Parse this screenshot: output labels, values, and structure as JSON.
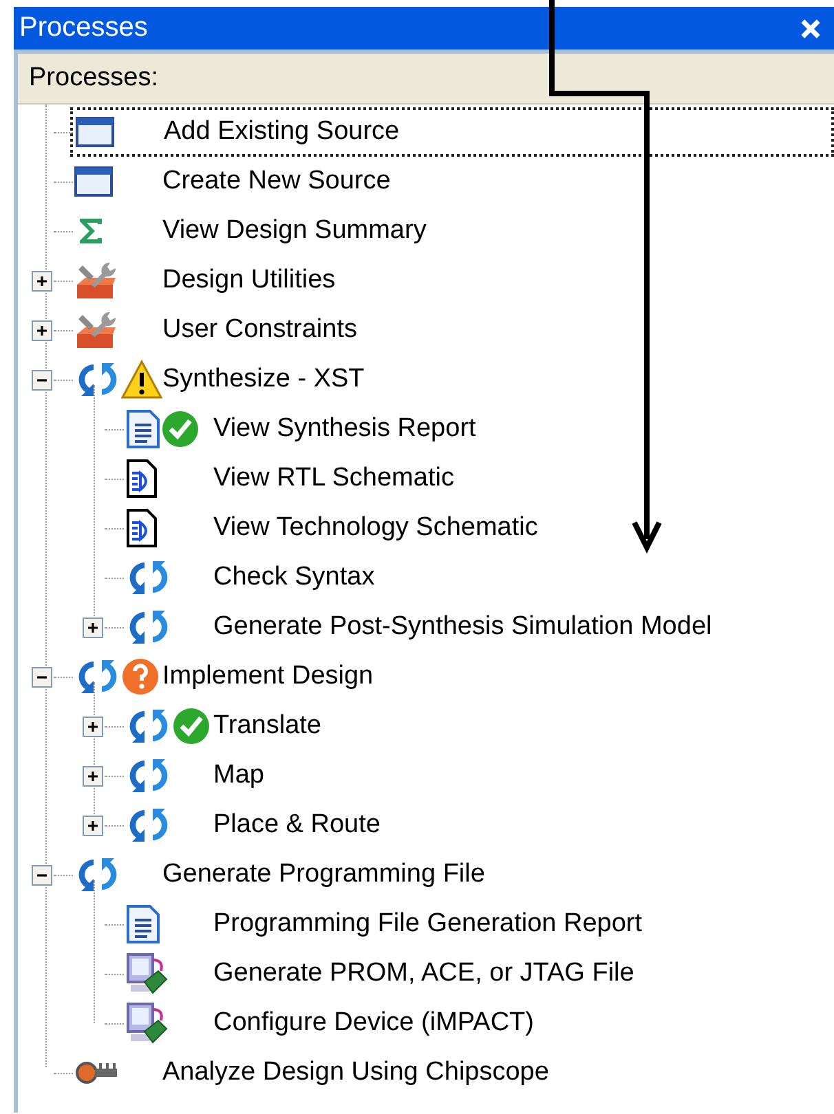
{
  "title": "Processes",
  "header": "Processes:",
  "items": [
    {
      "label": "Add Existing Source",
      "kind": "window",
      "selected": true
    },
    {
      "label": "Create New Source",
      "kind": "window",
      "selected": false
    },
    {
      "label": "View Design Summary",
      "kind": "sigma",
      "selected": false
    },
    {
      "label": "Design Utilities",
      "kind": "tools",
      "selected": false,
      "expanded": false
    },
    {
      "label": "User Constraints",
      "kind": "tools",
      "selected": false,
      "expanded": false
    },
    {
      "label": "Synthesize - XST",
      "kind": "run",
      "badge": {
        "kind": "warning"
      },
      "selected": false,
      "expanded": true,
      "children": [
        {
          "label": "View Synthesis Report",
          "kind": "report",
          "badge": {
            "kind": "ok"
          },
          "selected": false
        },
        {
          "label": "View RTL Schematic",
          "kind": "schematic",
          "selected": false
        },
        {
          "label": "View Technology Schematic",
          "kind": "schematic",
          "selected": false
        },
        {
          "label": "Check Syntax",
          "kind": "run",
          "selected": false
        },
        {
          "label": "Generate Post-Synthesis Simulation Model",
          "kind": "run",
          "selected": false,
          "expanded": false
        }
      ]
    },
    {
      "label": "Implement Design",
      "kind": "run",
      "badge": {
        "kind": "question"
      },
      "selected": false,
      "expanded": true,
      "children": [
        {
          "label": "Translate",
          "kind": "run",
          "badge": {
            "kind": "ok"
          },
          "selected": false,
          "expanded": false
        },
        {
          "label": "Map",
          "kind": "run",
          "selected": false,
          "expanded": false
        },
        {
          "label": "Place & Route",
          "kind": "run",
          "selected": false,
          "expanded": false
        }
      ]
    },
    {
      "label": "Generate Programming File",
      "kind": "run",
      "selected": false,
      "expanded": true,
      "children": [
        {
          "label": "Programming File Generation Report",
          "kind": "report",
          "selected": false
        },
        {
          "label": "Generate PROM, ACE, or JTAG File",
          "kind": "device",
          "selected": false
        },
        {
          "label": "Configure Device (iMPACT)",
          "kind": "device",
          "selected": false
        }
      ]
    },
    {
      "label": "Analyze Design Using Chipscope",
      "kind": "probe",
      "selected": false
    }
  ]
}
